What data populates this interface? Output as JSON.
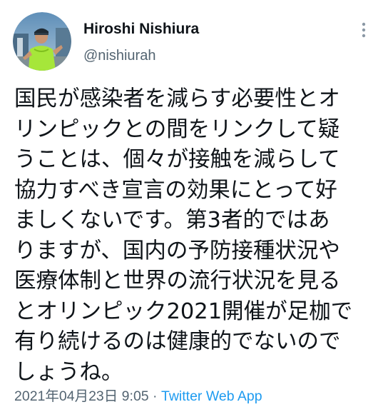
{
  "author": {
    "display_name": "Hiroshi Nishiura",
    "handle": "@nishiurah"
  },
  "icons": {
    "more": "more-vertical-icon",
    "avatar": "avatar-photo"
  },
  "tweet": {
    "lines": [
      "国民が感染者を減らす必要性とオ",
      "リンピックとの間をリンクして疑",
      "うことは、個々が接触を減らして",
      "協力すべき宣言の効果にとって好",
      "ましくないです。第3者的ではあ",
      "りますが、国内の予防接種状況や",
      "医療体制と世界の流行状況を見る",
      "とオリンピック2021開催が足枷で",
      "有り続けるのは健康的でないので",
      "しょうね。"
    ],
    "timestamp": "2021年04月23日 9:05",
    "separator": " · ",
    "source": "Twitter Web App"
  },
  "colors": {
    "text": "#0f1419",
    "secondary": "#536471",
    "link": "#1d9bf0",
    "background": "#ffffff"
  }
}
